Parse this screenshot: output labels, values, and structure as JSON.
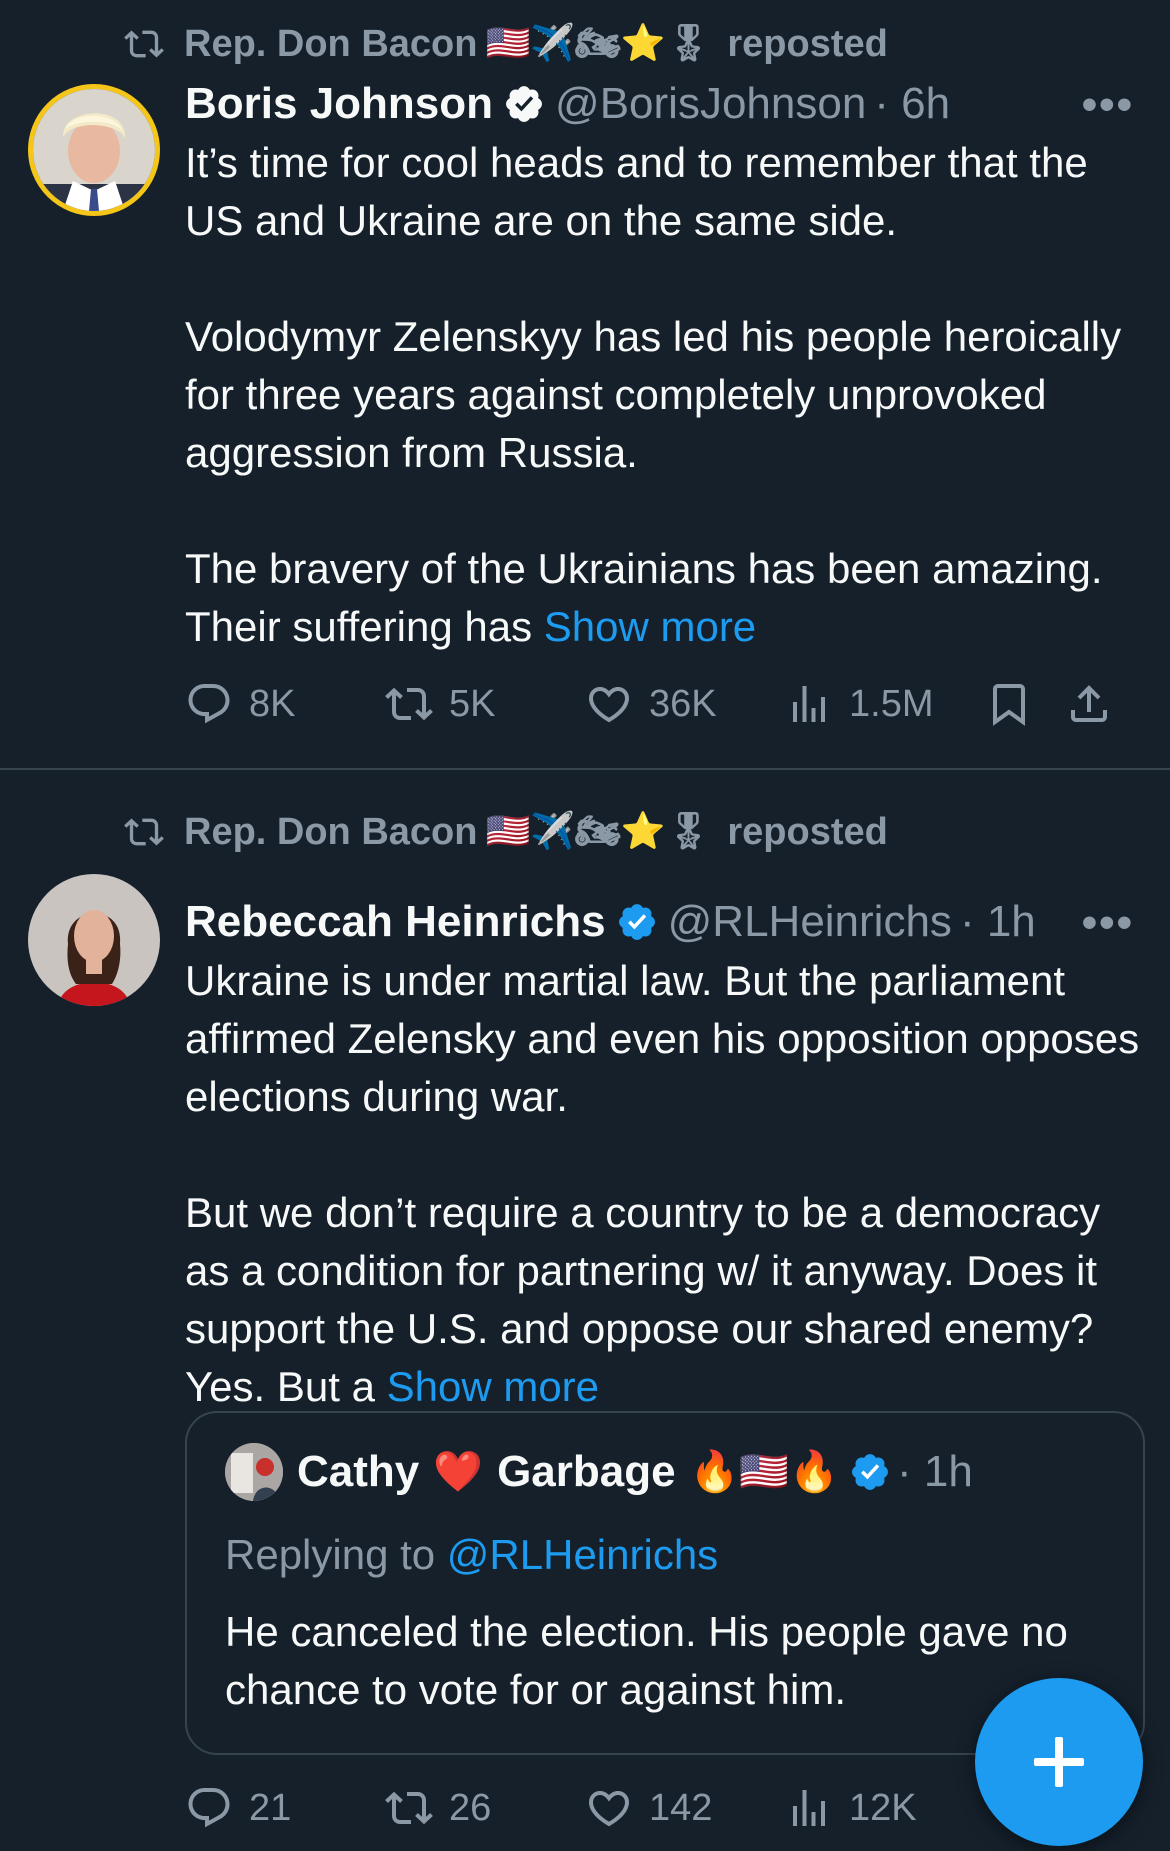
{
  "tweets": [
    {
      "repost": {
        "by": "Rep. Don Bacon",
        "emojis": "🇺🇸✈️🏍⭐🎖",
        "label": "reposted"
      },
      "author": {
        "name": "Boris Johnson",
        "handle": "@BorisJohnson",
        "time": "· 6h"
      },
      "paragraphs": [
        "It’s time for cool heads and to remember that the US and Ukraine are on the same side.",
        "Volodymyr Zelenskyy has led his people heroically for three years against completely unprovoked aggression from Russia.",
        "The bravery of the Ukrainians has been amazing. Their suffering has"
      ],
      "show_more": "Show more",
      "stats": {
        "replies": "8K",
        "reposts": "5K",
        "likes": "36K",
        "views": "1.5M"
      }
    },
    {
      "repost": {
        "by": "Rep. Don Bacon",
        "emojis": "🇺🇸✈️🏍⭐🎖",
        "label": "reposted"
      },
      "author": {
        "name": "Rebeccah Heinrichs",
        "handle": "@RLHeinrichs",
        "time": "· 1h"
      },
      "paragraphs": [
        "Ukraine is under martial law. But the parliament affirmed Zelensky and even his opposition opposes elections during war.",
        "But we don’t require a country to be a democracy as a condition for partnering w/ it anyway. Does it support the U.S. and oppose our shared enemy? Yes. But a"
      ],
      "show_more": "Show more",
      "quote": {
        "name_part1": "Cathy",
        "heart": "❤️",
        "name_part2": "Garbage",
        "emojis": "🔥🇺🇸🔥",
        "time": "· 1h",
        "replying_label": "Replying to",
        "replying_to": "@RLHeinrichs",
        "text": "He canceled the election. His people gave no chance to vote for or against him."
      },
      "stats": {
        "replies": "21",
        "reposts": "26",
        "likes": "142",
        "views": "12K"
      }
    }
  ],
  "more_label": "•••",
  "fab_label": "+",
  "colors": {
    "background": "#15202b",
    "accent": "#1d9bf0",
    "muted": "#8b98a5",
    "verified": "#1d9bf0"
  }
}
